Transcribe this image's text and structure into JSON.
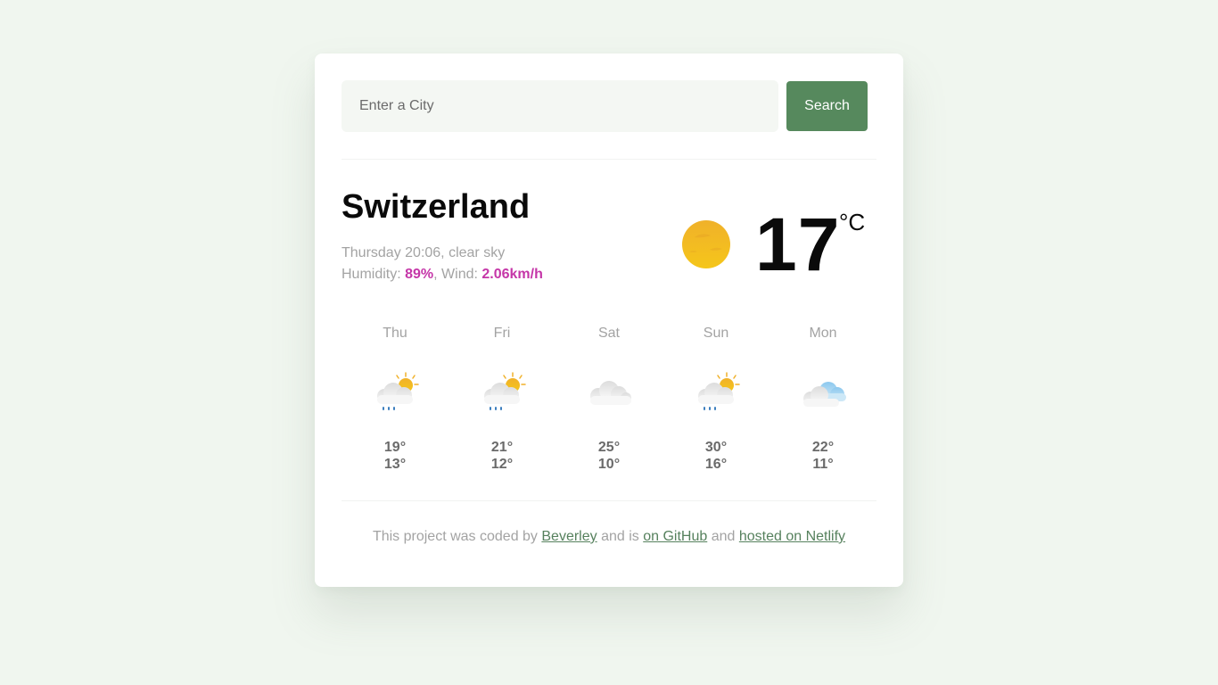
{
  "search": {
    "placeholder": "Enter a City",
    "button_label": "Search"
  },
  "current": {
    "city": "Switzerland",
    "datetime_description": "Thursday 20:06, clear sky",
    "humidity_label": "Humidity: ",
    "humidity_value": "89%",
    "wind_label": ", Wind: ",
    "wind_value": "2.06km/h",
    "temperature": "17",
    "unit": "°C",
    "icon": "clear-sky-sun-icon"
  },
  "forecast": [
    {
      "day": "Thu",
      "max": "19°",
      "min": "13°",
      "icon": "sun-cloud-rain-icon"
    },
    {
      "day": "Fri",
      "max": "21°",
      "min": "12°",
      "icon": "sun-cloud-rain-icon"
    },
    {
      "day": "Sat",
      "max": "25°",
      "min": "10°",
      "icon": "cloud-icon"
    },
    {
      "day": "Sun",
      "max": "30°",
      "min": "16°",
      "icon": "sun-cloud-rain-icon"
    },
    {
      "day": "Mon",
      "max": "22°",
      "min": "11°",
      "icon": "clouds-icon"
    }
  ],
  "footer": {
    "text_1": "This project was coded by ",
    "link_author": "Beverley",
    "text_2": " and is ",
    "link_github": "on GitHub",
    "text_3": " and ",
    "link_netlify": "hosted on Netlify"
  },
  "colors": {
    "page_background": "#f0f6ef",
    "accent_button": "#56895d",
    "highlight": "#c536a8",
    "link": "#56815d"
  }
}
